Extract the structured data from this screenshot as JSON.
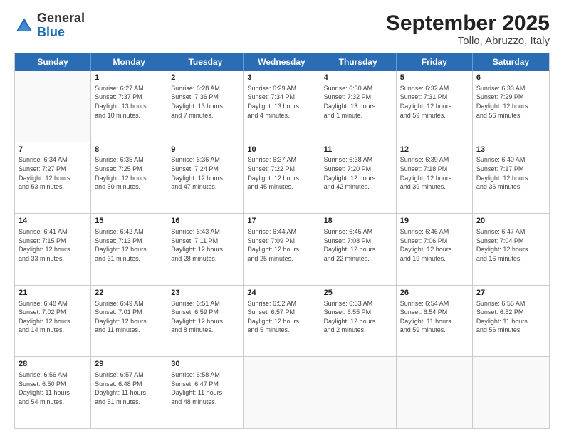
{
  "header": {
    "logo_general": "General",
    "logo_blue": "Blue",
    "month_title": "September 2025",
    "subtitle": "Tollo, Abruzzo, Italy"
  },
  "weekdays": [
    "Sunday",
    "Monday",
    "Tuesday",
    "Wednesday",
    "Thursday",
    "Friday",
    "Saturday"
  ],
  "rows": [
    [
      {
        "day": "",
        "info": ""
      },
      {
        "day": "1",
        "info": "Sunrise: 6:27 AM\nSunset: 7:37 PM\nDaylight: 13 hours\nand 10 minutes."
      },
      {
        "day": "2",
        "info": "Sunrise: 6:28 AM\nSunset: 7:36 PM\nDaylight: 13 hours\nand 7 minutes."
      },
      {
        "day": "3",
        "info": "Sunrise: 6:29 AM\nSunset: 7:34 PM\nDaylight: 13 hours\nand 4 minutes."
      },
      {
        "day": "4",
        "info": "Sunrise: 6:30 AM\nSunset: 7:32 PM\nDaylight: 13 hours\nand 1 minute."
      },
      {
        "day": "5",
        "info": "Sunrise: 6:32 AM\nSunset: 7:31 PM\nDaylight: 12 hours\nand 59 minutes."
      },
      {
        "day": "6",
        "info": "Sunrise: 6:33 AM\nSunset: 7:29 PM\nDaylight: 12 hours\nand 56 minutes."
      }
    ],
    [
      {
        "day": "7",
        "info": "Sunrise: 6:34 AM\nSunset: 7:27 PM\nDaylight: 12 hours\nand 53 minutes."
      },
      {
        "day": "8",
        "info": "Sunrise: 6:35 AM\nSunset: 7:25 PM\nDaylight: 12 hours\nand 50 minutes."
      },
      {
        "day": "9",
        "info": "Sunrise: 6:36 AM\nSunset: 7:24 PM\nDaylight: 12 hours\nand 47 minutes."
      },
      {
        "day": "10",
        "info": "Sunrise: 6:37 AM\nSunset: 7:22 PM\nDaylight: 12 hours\nand 45 minutes."
      },
      {
        "day": "11",
        "info": "Sunrise: 6:38 AM\nSunset: 7:20 PM\nDaylight: 12 hours\nand 42 minutes."
      },
      {
        "day": "12",
        "info": "Sunrise: 6:39 AM\nSunset: 7:18 PM\nDaylight: 12 hours\nand 39 minutes."
      },
      {
        "day": "13",
        "info": "Sunrise: 6:40 AM\nSunset: 7:17 PM\nDaylight: 12 hours\nand 36 minutes."
      }
    ],
    [
      {
        "day": "14",
        "info": "Sunrise: 6:41 AM\nSunset: 7:15 PM\nDaylight: 12 hours\nand 33 minutes."
      },
      {
        "day": "15",
        "info": "Sunrise: 6:42 AM\nSunset: 7:13 PM\nDaylight: 12 hours\nand 31 minutes."
      },
      {
        "day": "16",
        "info": "Sunrise: 6:43 AM\nSunset: 7:11 PM\nDaylight: 12 hours\nand 28 minutes."
      },
      {
        "day": "17",
        "info": "Sunrise: 6:44 AM\nSunset: 7:09 PM\nDaylight: 12 hours\nand 25 minutes."
      },
      {
        "day": "18",
        "info": "Sunrise: 6:45 AM\nSunset: 7:08 PM\nDaylight: 12 hours\nand 22 minutes."
      },
      {
        "day": "19",
        "info": "Sunrise: 6:46 AM\nSunset: 7:06 PM\nDaylight: 12 hours\nand 19 minutes."
      },
      {
        "day": "20",
        "info": "Sunrise: 6:47 AM\nSunset: 7:04 PM\nDaylight: 12 hours\nand 16 minutes."
      }
    ],
    [
      {
        "day": "21",
        "info": "Sunrise: 6:48 AM\nSunset: 7:02 PM\nDaylight: 12 hours\nand 14 minutes."
      },
      {
        "day": "22",
        "info": "Sunrise: 6:49 AM\nSunset: 7:01 PM\nDaylight: 12 hours\nand 11 minutes."
      },
      {
        "day": "23",
        "info": "Sunrise: 6:51 AM\nSunset: 6:59 PM\nDaylight: 12 hours\nand 8 minutes."
      },
      {
        "day": "24",
        "info": "Sunrise: 6:52 AM\nSunset: 6:57 PM\nDaylight: 12 hours\nand 5 minutes."
      },
      {
        "day": "25",
        "info": "Sunrise: 6:53 AM\nSunset: 6:55 PM\nDaylight: 12 hours\nand 2 minutes."
      },
      {
        "day": "26",
        "info": "Sunrise: 6:54 AM\nSunset: 6:54 PM\nDaylight: 11 hours\nand 59 minutes."
      },
      {
        "day": "27",
        "info": "Sunrise: 6:55 AM\nSunset: 6:52 PM\nDaylight: 11 hours\nand 56 minutes."
      }
    ],
    [
      {
        "day": "28",
        "info": "Sunrise: 6:56 AM\nSunset: 6:50 PM\nDaylight: 11 hours\nand 54 minutes."
      },
      {
        "day": "29",
        "info": "Sunrise: 6:57 AM\nSunset: 6:48 PM\nDaylight: 11 hours\nand 51 minutes."
      },
      {
        "day": "30",
        "info": "Sunrise: 6:58 AM\nSunset: 6:47 PM\nDaylight: 11 hours\nand 48 minutes."
      },
      {
        "day": "",
        "info": ""
      },
      {
        "day": "",
        "info": ""
      },
      {
        "day": "",
        "info": ""
      },
      {
        "day": "",
        "info": ""
      }
    ]
  ]
}
